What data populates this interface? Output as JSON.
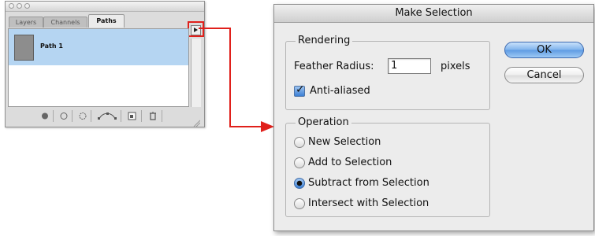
{
  "palette": {
    "tabs": [
      "Layers",
      "Channels",
      "Paths"
    ],
    "active_tab": "Paths",
    "path_name": "Path 1",
    "bottom_buttons": [
      "fill-path-icon",
      "stroke-path-icon",
      "load-as-selection-icon",
      "make-work-path-icon",
      "new-path-icon",
      "delete-path-icon"
    ]
  },
  "dialog": {
    "title": "Make Selection",
    "rendering": {
      "legend": "Rendering",
      "feather_label": "Feather Radius:",
      "feather_value": "1",
      "feather_unit": "pixels",
      "antialias_label": "Anti-aliased",
      "antialias_checked": true
    },
    "operation": {
      "legend": "Operation",
      "options": [
        "New Selection",
        "Add to Selection",
        "Subtract from Selection",
        "Intersect with Selection"
      ],
      "selected": "Subtract from Selection"
    },
    "ok_label": "OK",
    "cancel_label": "Cancel"
  },
  "colors": {
    "highlight_arrow": "#e0201b",
    "selected_row": "#b5d5f2"
  }
}
